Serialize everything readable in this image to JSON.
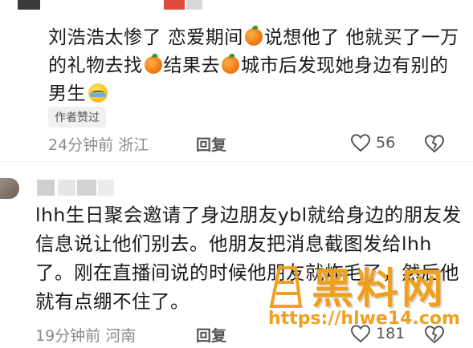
{
  "colors": {
    "text": "#1a1a1a",
    "meta": "#8a8a8a",
    "badge_bg": "#f0f0f0",
    "watermark": "#f0a020"
  },
  "comment1": {
    "line1a": "刘浩浩太惨了 恋爱期间",
    "line1b": "说想他了 他就买了一万",
    "line2a": "的礼物去找",
    "line2b": "结果去",
    "line2c": "城市后发现她身边有别的",
    "line3": "男生",
    "emojis": [
      "orange-emoji",
      "orange-emoji",
      "orange-emoji",
      "crying-laughing-emoji"
    ],
    "badge": "作者赞过",
    "time": "24分钟前 浙江",
    "reply": "回复",
    "likes": "56"
  },
  "comment2": {
    "line1": "lhh生日聚会邀请了身边朋友ybl就给身边的朋友发",
    "line2": "信息说让他们别去。他朋友把消息截图发给lhh",
    "line3": "了。刚在直播间说的时候他朋友就炸毛了，然后他",
    "line4": "就有点绷不住了。",
    "time": "19分钟前 河南",
    "reply": "回复",
    "likes": "181"
  },
  "watermark": {
    "title": "黑料网",
    "url": "https://hlwe14.com"
  }
}
